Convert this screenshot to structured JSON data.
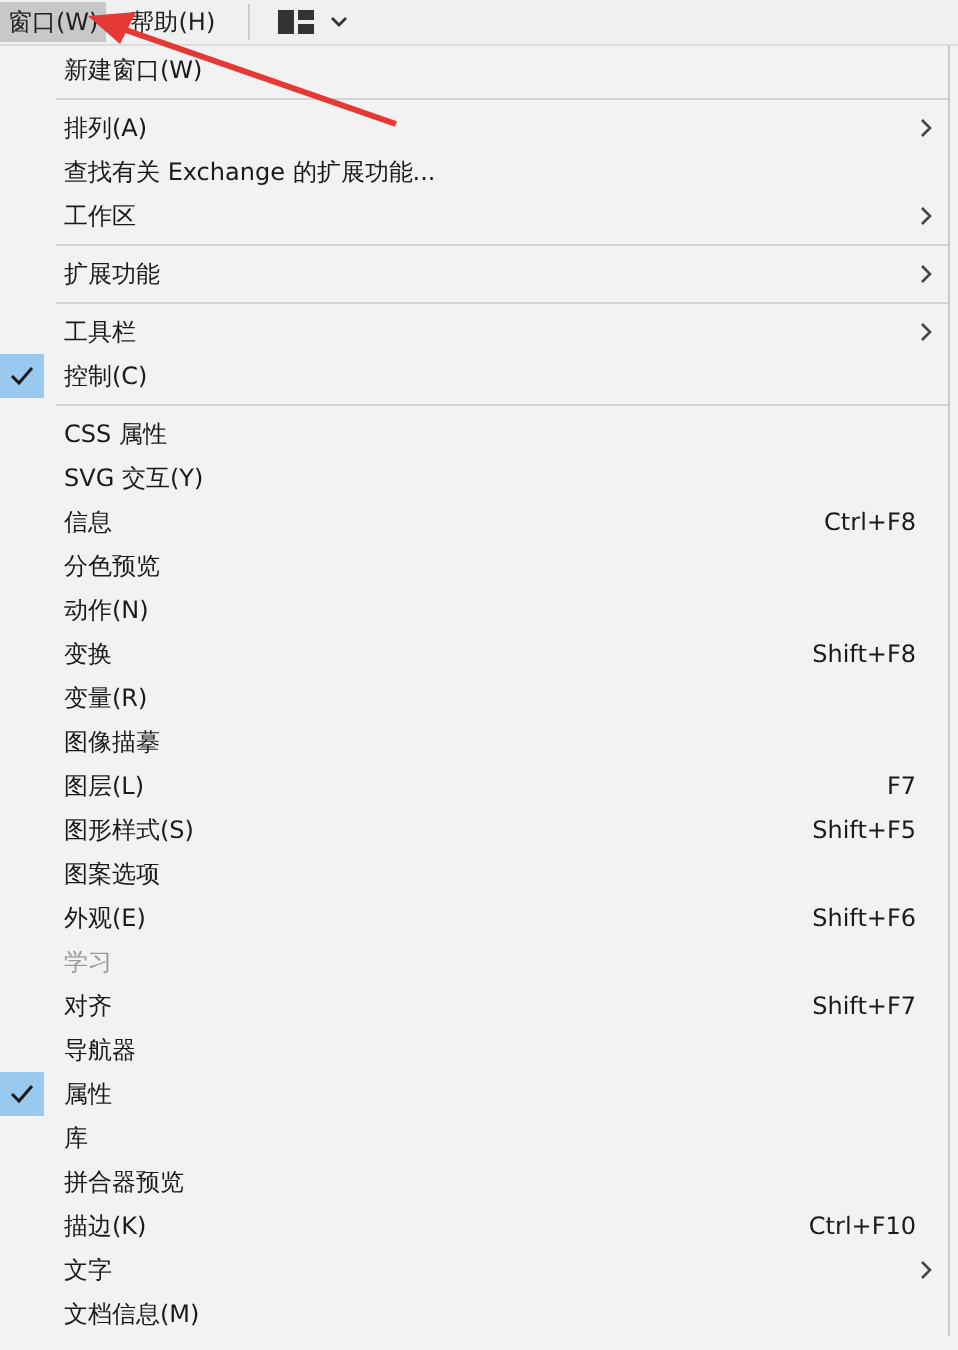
{
  "menubar": [
    {
      "label": "窗口(W)",
      "selected": true
    },
    {
      "label": "帮助(H)",
      "selected": false
    }
  ],
  "menu_groups": [
    [
      {
        "label": "新建窗口(W)",
        "submenu": false,
        "checked": false,
        "disabled": false
      }
    ],
    [
      {
        "label": "排列(A)",
        "submenu": true,
        "checked": false,
        "disabled": false
      },
      {
        "label": "查找有关 Exchange 的扩展功能...",
        "submenu": false,
        "checked": false,
        "disabled": false
      },
      {
        "label": "工作区",
        "submenu": true,
        "checked": false,
        "disabled": false
      }
    ],
    [
      {
        "label": "扩展功能",
        "submenu": true,
        "checked": false,
        "disabled": false
      }
    ],
    [
      {
        "label": "工具栏",
        "submenu": true,
        "checked": false,
        "disabled": false
      },
      {
        "label": "控制(C)",
        "submenu": false,
        "checked": true,
        "disabled": false
      }
    ],
    [
      {
        "label": "CSS 属性",
        "submenu": false,
        "checked": false,
        "disabled": false
      },
      {
        "label": "SVG 交互(Y)",
        "submenu": false,
        "checked": false,
        "disabled": false
      },
      {
        "label": "信息",
        "shortcut": "Ctrl+F8",
        "submenu": false,
        "checked": false,
        "disabled": false
      },
      {
        "label": "分色预览",
        "submenu": false,
        "checked": false,
        "disabled": false
      },
      {
        "label": "动作(N)",
        "submenu": false,
        "checked": false,
        "disabled": false
      },
      {
        "label": "变换",
        "shortcut": "Shift+F8",
        "submenu": false,
        "checked": false,
        "disabled": false
      },
      {
        "label": "变量(R)",
        "submenu": false,
        "checked": false,
        "disabled": false
      },
      {
        "label": "图像描摹",
        "submenu": false,
        "checked": false,
        "disabled": false
      },
      {
        "label": "图层(L)",
        "shortcut": "F7",
        "submenu": false,
        "checked": false,
        "disabled": false
      },
      {
        "label": "图形样式(S)",
        "shortcut": "Shift+F5",
        "submenu": false,
        "checked": false,
        "disabled": false
      },
      {
        "label": "图案选项",
        "submenu": false,
        "checked": false,
        "disabled": false
      },
      {
        "label": "外观(E)",
        "shortcut": "Shift+F6",
        "submenu": false,
        "checked": false,
        "disabled": false
      },
      {
        "label": "学习",
        "submenu": false,
        "checked": false,
        "disabled": true
      },
      {
        "label": "对齐",
        "shortcut": "Shift+F7",
        "submenu": false,
        "checked": false,
        "disabled": false
      },
      {
        "label": "导航器",
        "submenu": false,
        "checked": false,
        "disabled": false
      },
      {
        "label": "属性",
        "submenu": false,
        "checked": true,
        "disabled": false
      },
      {
        "label": "库",
        "submenu": false,
        "checked": false,
        "disabled": false
      },
      {
        "label": "拼合器预览",
        "submenu": false,
        "checked": false,
        "disabled": false
      },
      {
        "label": "描边(K)",
        "shortcut": "Ctrl+F10",
        "submenu": false,
        "checked": false,
        "disabled": false
      },
      {
        "label": "文字",
        "submenu": true,
        "checked": false,
        "disabled": false
      },
      {
        "label": "文档信息(M)",
        "submenu": false,
        "checked": false,
        "disabled": false
      }
    ]
  ]
}
